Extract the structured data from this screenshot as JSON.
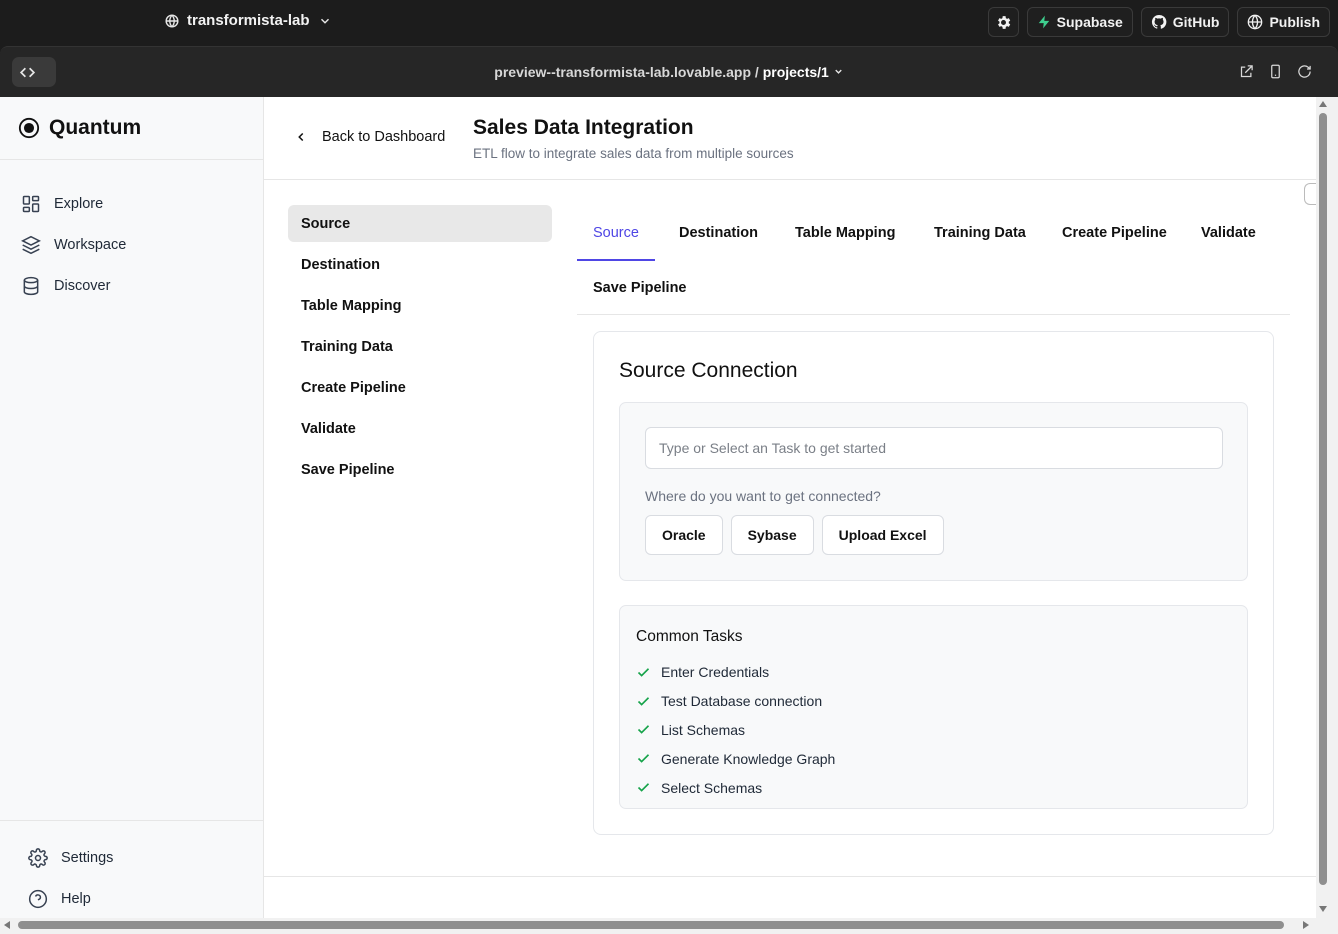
{
  "topbar": {
    "project_name": "transformista-lab",
    "buttons": {
      "supabase": "Supabase",
      "github": "GitHub",
      "publish": "Publish"
    }
  },
  "browser": {
    "url_host": "preview--transformista-lab.lovable.app / ",
    "url_path": "projects/1"
  },
  "sidebar": {
    "brand": "Quantum",
    "items": [
      {
        "label": "Explore",
        "icon": "grid-icon"
      },
      {
        "label": "Workspace",
        "icon": "layers-icon"
      },
      {
        "label": "Discover",
        "icon": "database-icon"
      }
    ],
    "bottom_items": [
      {
        "label": "Settings",
        "icon": "gear-icon"
      },
      {
        "label": "Help",
        "icon": "help-icon"
      }
    ]
  },
  "header": {
    "back_label": "Back to Dashboard",
    "title": "Sales Data Integration",
    "subtitle": "ETL flow to integrate sales data from multiple sources"
  },
  "steps": [
    "Source",
    "Destination",
    "Table Mapping",
    "Training Data",
    "Create Pipeline",
    "Validate",
    "Save Pipeline"
  ],
  "tabs": [
    "Source",
    "Destination",
    "Table Mapping",
    "Training Data",
    "Create Pipeline",
    "Validate",
    "Save Pipeline"
  ],
  "source_card": {
    "title": "Source Connection",
    "input_placeholder": "Type or Select an Task to get started",
    "prompt": "Where do you want to get connected?",
    "options": [
      "Oracle",
      "Sybase",
      "Upload Excel"
    ]
  },
  "common_tasks": {
    "title": "Common Tasks",
    "items": [
      "Enter Credentials",
      "Test Database connection",
      "List Schemas",
      "Generate Knowledge Graph",
      "Select Schemas"
    ]
  },
  "colors": {
    "accent": "#4f46e5",
    "check": "#16a34a",
    "supabase": "#3ecf8e"
  }
}
